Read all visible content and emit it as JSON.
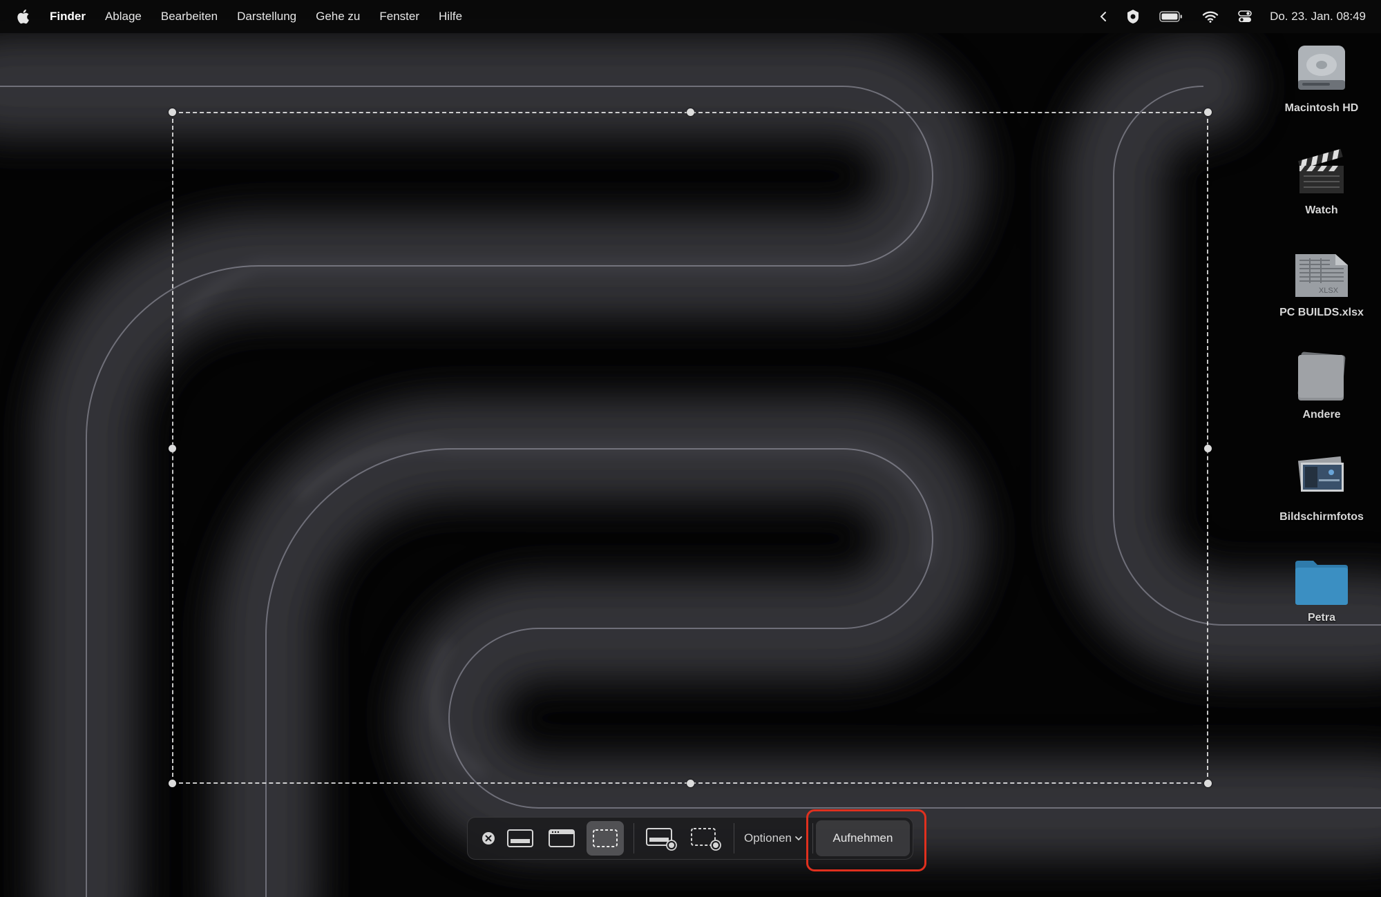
{
  "menubar": {
    "app_name": "Finder",
    "items": [
      "Ablage",
      "Bearbeiten",
      "Darstellung",
      "Gehe zu",
      "Fenster",
      "Hilfe"
    ],
    "clock": "Do. 23. Jan.  08:49",
    "status_icons": [
      "chevron-left-icon",
      "vpn-shield-icon",
      "battery-icon",
      "wifi-icon",
      "control-center-icon"
    ]
  },
  "desktop": {
    "icons": [
      {
        "label": "Macintosh HD",
        "icon": "hard-drive-icon"
      },
      {
        "label": "Watch",
        "icon": "clapperboard-icon"
      },
      {
        "label": "PC BUILDS.xlsx",
        "icon": "spreadsheet-file-icon",
        "file_badge": "XLSX"
      },
      {
        "label": "Andere",
        "icon": "folder-stack-icon"
      },
      {
        "label": "Bildschirmfotos",
        "icon": "screenshot-stack-icon"
      },
      {
        "label": "Petra",
        "icon": "folder-icon"
      }
    ]
  },
  "toolbar": {
    "tools": [
      "close-icon",
      "capture-entire-screen-icon",
      "capture-window-icon",
      "capture-selection-icon",
      "record-entire-screen-icon",
      "record-selection-icon"
    ],
    "selected_tool": "capture-selection-icon",
    "options_label": "Optionen",
    "capture_label": "Aufnehmen"
  },
  "colors": {
    "highlight": "#e0301e",
    "folder_blue": "#3b8fc2"
  }
}
